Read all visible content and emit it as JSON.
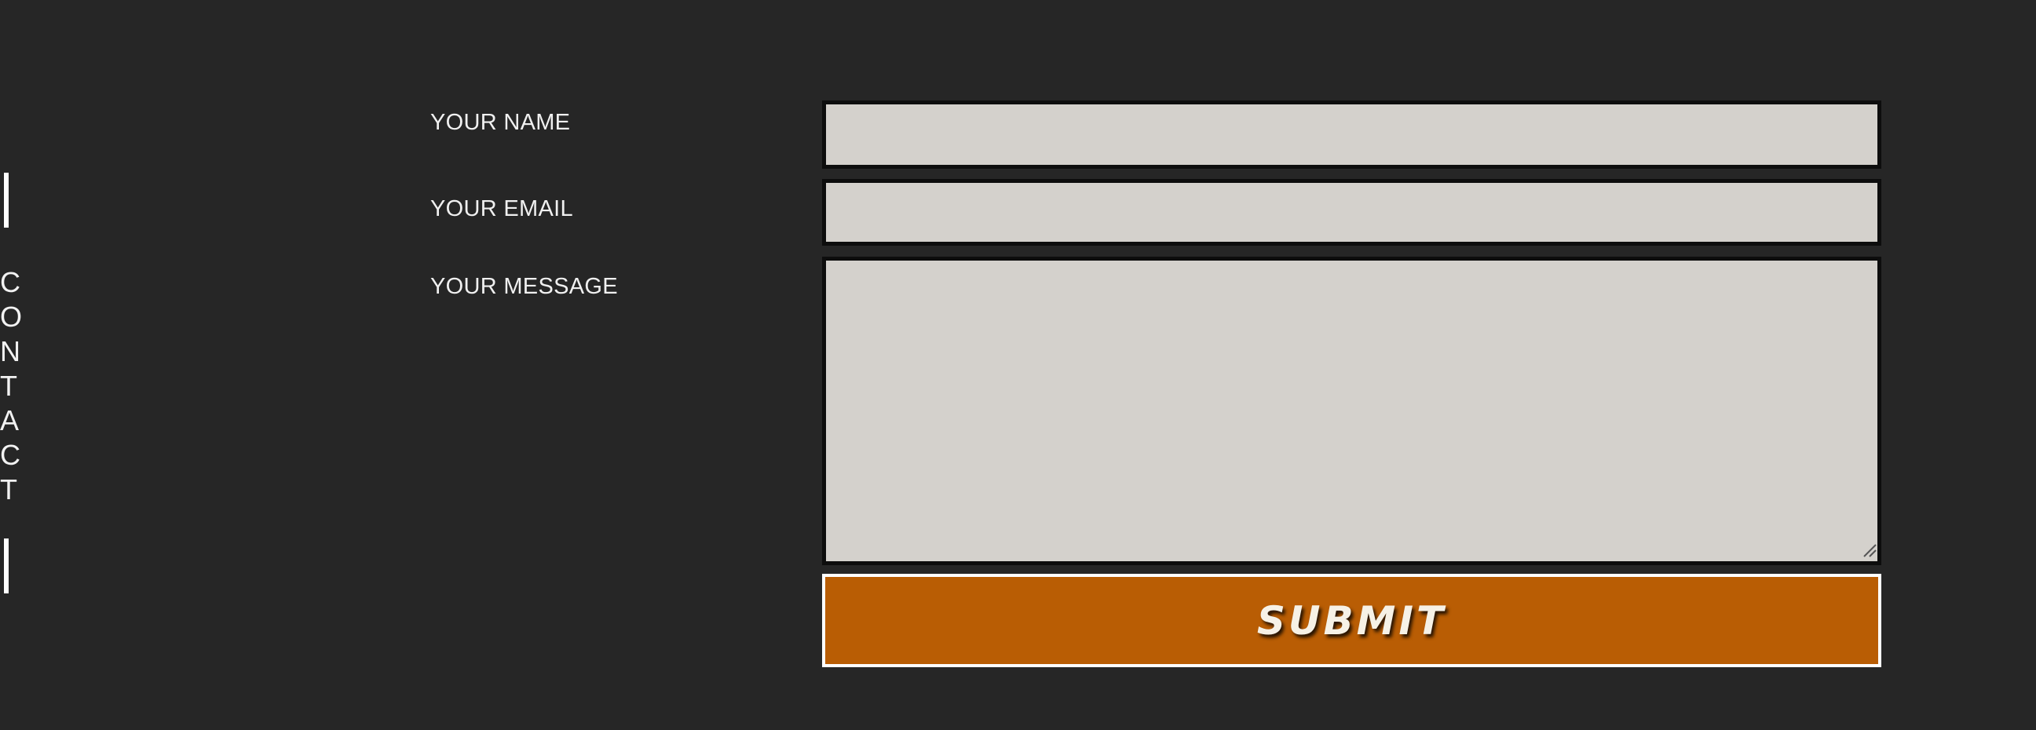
{
  "side_label": {
    "letters": [
      "C",
      "O",
      "N",
      "T",
      "A",
      "C",
      "T"
    ]
  },
  "form": {
    "name_label": "YOUR NAME",
    "name_value": "",
    "email_label": "YOUR EMAIL",
    "email_value": "",
    "message_label": "YOUR MESSAGE",
    "message_value": "",
    "submit_label": "SUBMIT"
  },
  "colors": {
    "background": "#262626",
    "field_fill": "#d4d1cc",
    "field_border": "#0d0d0d",
    "submit_fill": "#b95d04",
    "submit_border": "#ffffff",
    "text": "#f0f0f0"
  },
  "icons": {
    "resize_grip": "resize-grip-icon"
  }
}
